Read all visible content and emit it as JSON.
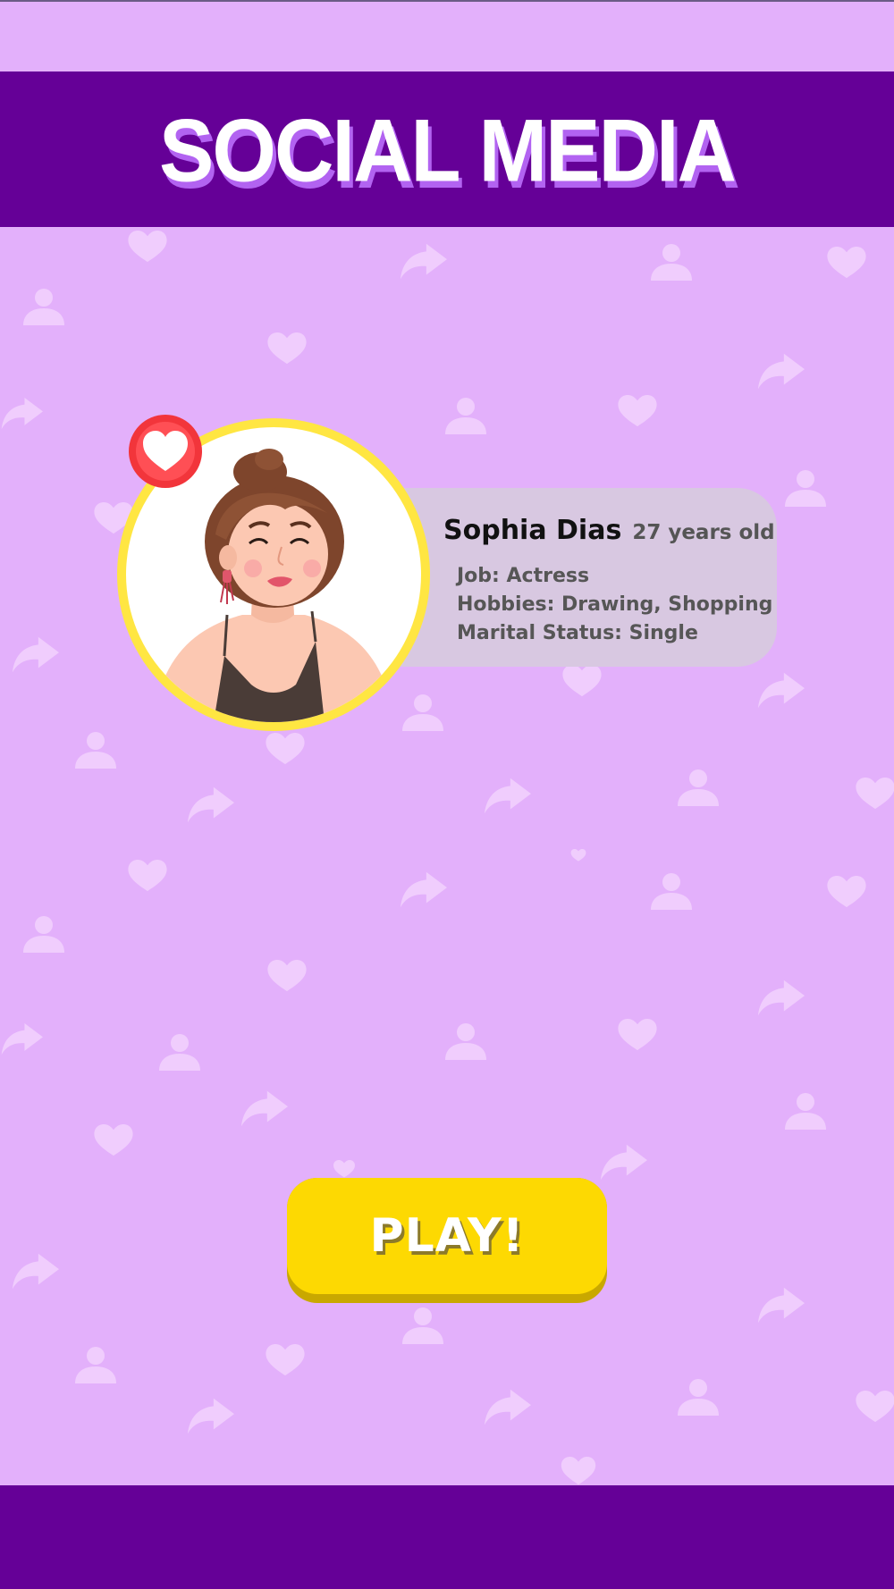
{
  "header": {
    "title": "SOCIAL MEDIA"
  },
  "profile": {
    "name": "Sophia Dias",
    "age": "27 years old",
    "job": "Job: Actress",
    "hobbies": "Hobbies: Drawing, Shopping",
    "marital_status": "Marital Status: Single",
    "avatar": "woman-portrait",
    "badge_icon": "heart-icon"
  },
  "actions": {
    "play_label": "PLAY!"
  },
  "background_icons": [
    "heart-icon",
    "share-arrow-icon",
    "user-icon"
  ],
  "colors": {
    "background": "#e3b0fb",
    "band": "#650097",
    "title_shadow": "#b263f1",
    "ring": "#ffe642",
    "button": "#fdd902",
    "card": "#d8c8e1",
    "badge": "#f2353b"
  }
}
